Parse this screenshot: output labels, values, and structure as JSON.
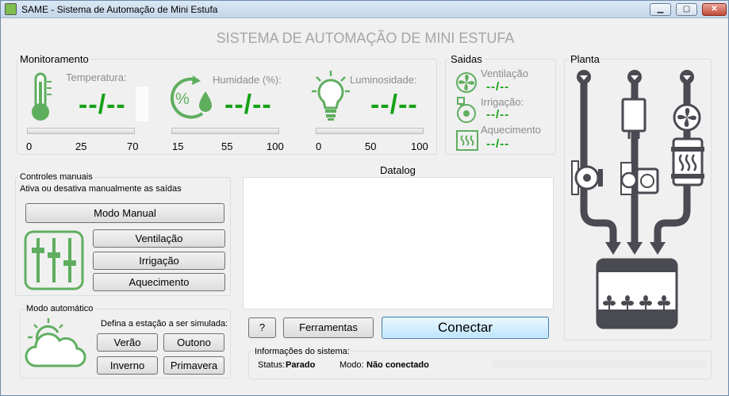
{
  "window": {
    "title": "SAME - Sistema de Automação de Mini Estufa"
  },
  "heading": "SISTEMA DE AUTOMAÇÃO DE MINI ESTUFA",
  "monitoring": {
    "title": "Monitoramento",
    "temperature": {
      "label": "Temperatura:",
      "value": "--/--",
      "min": "0",
      "mid": "25",
      "max": "70"
    },
    "humidity": {
      "label": "Humidade (%):",
      "value": "--/--",
      "min": "15",
      "mid": "55",
      "max": "100"
    },
    "luminosity": {
      "label": "Luminosidade:",
      "value": "--/--",
      "min": "0",
      "mid": "50",
      "max": "100"
    }
  },
  "outputs": {
    "title": "Saidas",
    "ventilation": {
      "label": "Ventilação",
      "value": "--/--"
    },
    "irrigation": {
      "label": "Irrigação:",
      "value": "--/--"
    },
    "heating": {
      "label": "Aquecimento",
      "value": "--/--"
    }
  },
  "plant": {
    "title": "Planta"
  },
  "manual": {
    "title": "Controles manuais",
    "subtitle": "Ativa ou desativa manualmente as saídas",
    "mode_button": "Modo Manual",
    "ventilation_button": "Ventilação",
    "irrigation_button": "Irrigação",
    "heating_button": "Aquecimento"
  },
  "automatic": {
    "title": "Modo automático",
    "subtitle": "Defina a estação a ser simulada:",
    "summer": "Verão",
    "autumn": "Outono",
    "winter": "Inverno",
    "spring": "Primavera"
  },
  "datalog": {
    "title": "Datalog"
  },
  "actions": {
    "help": "?",
    "tools": "Ferramentas",
    "connect": "Conectar"
  },
  "system_info": {
    "title": "Informações do sistema:",
    "status_label": "Status:",
    "status_value": "Parado",
    "mode_label": "Modo:",
    "mode_value": "Não conectado"
  },
  "colors": {
    "accent_green": "#16a216",
    "icon_green": "#5fae5f",
    "pipe": "#4a4a52"
  }
}
